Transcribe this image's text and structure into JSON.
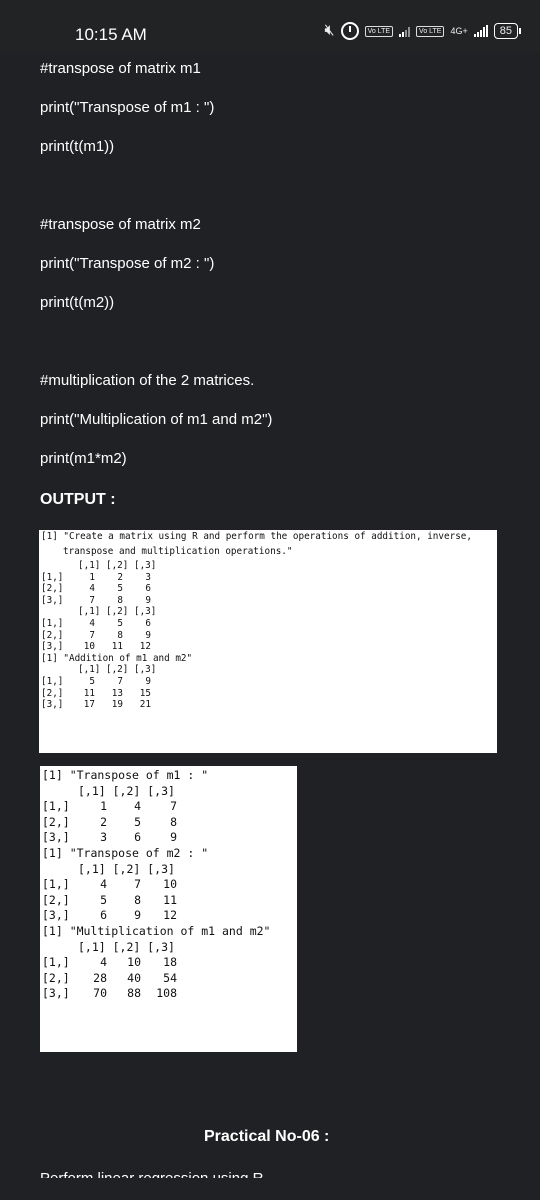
{
  "status_bar": {
    "time": "10:15 AM",
    "lte1": "Vo LTE",
    "lte2": "Vo LTE",
    "network": "4G+",
    "battery": "85"
  },
  "document": {
    "lines": [
      "#transpose of matrix m1",
      "print(\"Transpose of m1 : \")",
      "print(t(m1))",
      "#transpose of matrix m2",
      "print(\"Transpose of m2 : \")",
      "print(t(m2))",
      "#multiplication of the 2 matrices.",
      "print(\"Multiplication of m1 and m2\")",
      "print(m1*m2)"
    ],
    "output_heading": "OUTPUT :",
    "practical_heading": "Practical No-06 :",
    "next_line_cut": "Perform linear regression using R"
  },
  "output1": {
    "intro_line1": "[1] \"Create a matrix using R and perform the operations of addition, inverse,",
    "intro_line2": "transpose and multiplication operations.\"",
    "col_header": "[,1] [,2] [,3]",
    "row_labels": [
      "[1,]",
      "[2,]",
      "[3,]"
    ],
    "m1": [
      [
        "1",
        "2",
        "3"
      ],
      [
        "4",
        "5",
        "6"
      ],
      [
        "7",
        "8",
        "9"
      ]
    ],
    "m2": [
      [
        "4",
        "5",
        "6"
      ],
      [
        "7",
        "8",
        "9"
      ],
      [
        "10",
        "11",
        "12"
      ]
    ],
    "addition_label": "[1] \"Addition of m1 and m2\"",
    "sum": [
      [
        "5",
        "7",
        "9"
      ],
      [
        "11",
        "13",
        "15"
      ],
      [
        "17",
        "19",
        "21"
      ]
    ]
  },
  "output2": {
    "transpose1_label": "[1] \"Transpose of m1 : \"",
    "col_header": "[,1] [,2] [,3]",
    "row_labels": [
      "[1,]",
      "[2,]",
      "[3,]"
    ],
    "t1": [
      [
        "1",
        "4",
        "7"
      ],
      [
        "2",
        "5",
        "8"
      ],
      [
        "3",
        "6",
        "9"
      ]
    ],
    "transpose2_label": "[1] \"Transpose of m2 : \"",
    "t2": [
      [
        "4",
        "7",
        "10"
      ],
      [
        "5",
        "8",
        "11"
      ],
      [
        "6",
        "9",
        "12"
      ]
    ],
    "mult_label": "[1] \"Multiplication of m1 and m2\"",
    "prod": [
      [
        "4",
        "10",
        "18"
      ],
      [
        "28",
        "40",
        "54"
      ],
      [
        "70",
        "88",
        "108"
      ]
    ]
  }
}
